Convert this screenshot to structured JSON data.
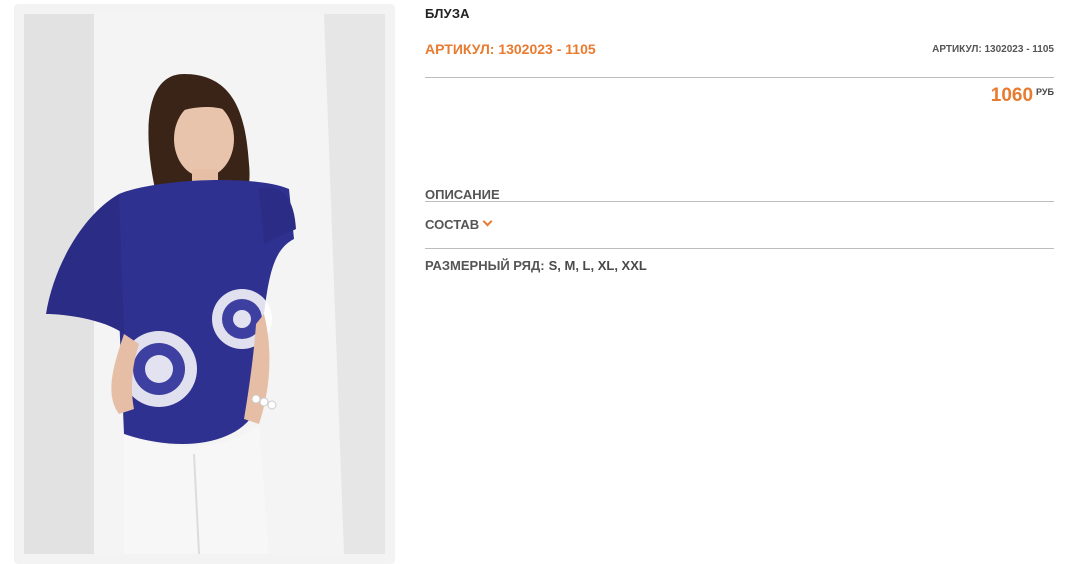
{
  "product": {
    "title": "БЛУЗА",
    "sku_label": "АРТИКУЛ: 1302023 - 1105",
    "sku_small": "АРТИКУЛ: 1302023 - 1105",
    "price": "1060",
    "currency": "РУБ"
  },
  "sections": {
    "description_label": "ОПИСАНИЕ",
    "composition_label": "СОСТАВ",
    "size_range_label": "РАЗМЕРНЫЙ РЯД:",
    "size_range_values": "S, M, L, XL, XXL"
  },
  "colors": {
    "accent": "#e87b30",
    "blouse": "#2f3190",
    "text": "#555555",
    "divider": "#bdbdbd"
  },
  "image": {
    "alt": "product-photo-model-in-blue-tie-dye-blouse"
  }
}
